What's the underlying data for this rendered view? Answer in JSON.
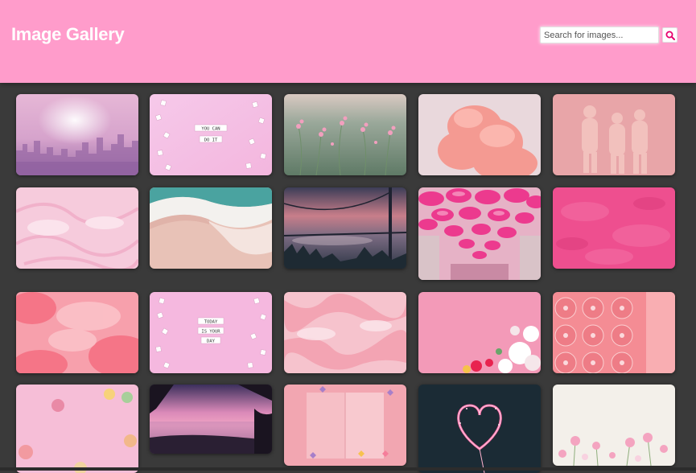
{
  "header": {
    "title": "Image Gallery",
    "search_placeholder": "Search for images...",
    "search_icon": "magnifier-icon"
  },
  "colors": {
    "header_bg": "#ff9ccb",
    "page_bg": "#3a3a3a",
    "accent": "#e6006e"
  },
  "gallery": {
    "images": [
      {
        "name": "city-skyline-pink-fog"
      },
      {
        "name": "letter-tiles-you-can-do-it",
        "text": "YOU CAN DO IT"
      },
      {
        "name": "pink-wildflowers-field"
      },
      {
        "name": "pink-smoke-cloud"
      },
      {
        "name": "pink-statues"
      },
      {
        "name": "pink-marble-texture"
      },
      {
        "name": "beach-waves-sand"
      },
      {
        "name": "bridge-pink-sunset"
      },
      {
        "name": "pink-umbrellas-street"
      },
      {
        "name": "pink-textured-wall"
      },
      {
        "name": "pink-clouds"
      },
      {
        "name": "letter-tiles-today-is-your-day",
        "text": "TODAY IS YOUR DAY"
      },
      {
        "name": "pink-marble-swirl"
      },
      {
        "name": "pink-flowers-corner"
      },
      {
        "name": "pink-vinyl-records"
      },
      {
        "name": "macarons-pink-background"
      },
      {
        "name": "tropical-beach-sunset"
      },
      {
        "name": "open-book-butterflies"
      },
      {
        "name": "sparkler-heart"
      },
      {
        "name": "cosmos-flowers-field"
      }
    ]
  }
}
